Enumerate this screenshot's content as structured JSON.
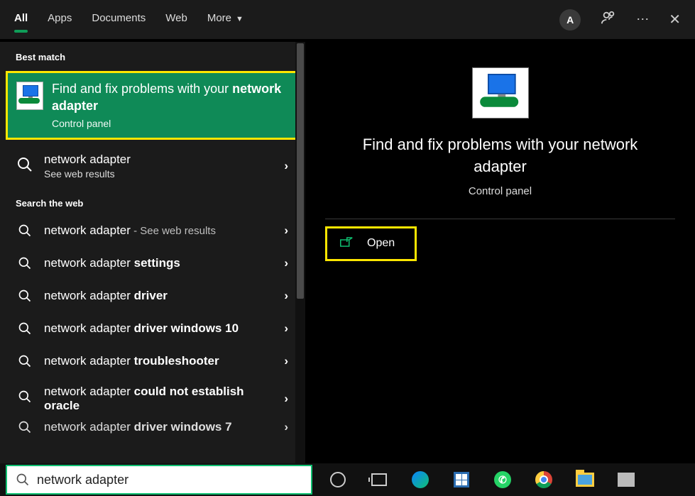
{
  "topbar": {
    "tabs": [
      "All",
      "Apps",
      "Documents",
      "Web",
      "More"
    ],
    "active": 0,
    "avatar_initial": "A"
  },
  "left": {
    "best_match_label": "Best match",
    "best": {
      "title_prefix": "Find and fix problems with your ",
      "title_bold": "network adapter",
      "subtitle": "Control panel"
    },
    "web_primary": {
      "title": "network adapter",
      "subtitle": "See web results"
    },
    "search_web_label": "Search the web",
    "suggestions": [
      {
        "prefix": "network adapter",
        "bold": "",
        "suffix_dim": " - See web results"
      },
      {
        "prefix": "network adapter ",
        "bold": "settings",
        "suffix_dim": ""
      },
      {
        "prefix": "network adapter ",
        "bold": "driver",
        "suffix_dim": ""
      },
      {
        "prefix": "network adapter ",
        "bold": "driver windows 10",
        "suffix_dim": ""
      },
      {
        "prefix": "network adapter ",
        "bold": "troubleshooter",
        "suffix_dim": ""
      },
      {
        "prefix": "network adapter ",
        "bold": "could not establish oracle",
        "suffix_dim": ""
      },
      {
        "prefix": "network adapter ",
        "bold": "driver windows 7",
        "suffix_dim": ""
      }
    ]
  },
  "right": {
    "title": "Find and fix problems with your network adapter",
    "subtitle": "Control panel",
    "open_label": "Open"
  },
  "search": {
    "value": "network adapter"
  }
}
